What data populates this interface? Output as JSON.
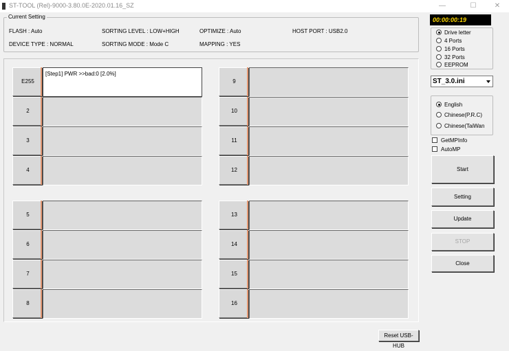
{
  "window": {
    "title": "ST-TOOL (Rel)-9000-3.80.0E-2020.01.16_SZ",
    "minimize_icon": "minimize-icon",
    "maximize_icon": "maximize-icon",
    "close_icon": "close-icon",
    "minimize_glyph": "—",
    "maximize_glyph": "☐",
    "close_glyph": "✕"
  },
  "current_setting": {
    "title": "Current Setting",
    "flash": "FLASH : Auto",
    "sorting_level": "SORTING LEVEL : LOW+HIGH",
    "optimize": "OPTIMIZE : Auto",
    "host_port": "HOST PORT : USB2.0",
    "device_type": "DEVICE TYPE : NORMAL",
    "sorting_mode": "SORTING MODE : Mode C",
    "mapping": "MAPPING : YES"
  },
  "ports": [
    {
      "label": "E255",
      "status": "[Step1] PWR  >>bad:0  [2.0%]",
      "active": true
    },
    {
      "label": "2",
      "status": ""
    },
    {
      "label": "3",
      "status": ""
    },
    {
      "label": "4",
      "status": ""
    },
    {
      "label": "5",
      "status": ""
    },
    {
      "label": "6",
      "status": ""
    },
    {
      "label": "7",
      "status": ""
    },
    {
      "label": "8",
      "status": ""
    },
    {
      "label": "9",
      "status": ""
    },
    {
      "label": "10",
      "status": ""
    },
    {
      "label": "11",
      "status": ""
    },
    {
      "label": "12",
      "status": ""
    },
    {
      "label": "13",
      "status": ""
    },
    {
      "label": "14",
      "status": ""
    },
    {
      "label": "15",
      "status": ""
    },
    {
      "label": "16",
      "status": ""
    }
  ],
  "timer": "00:00:00:19",
  "port_mode": {
    "options": [
      "Drive letter",
      "4 Ports",
      "16 Ports",
      "32 Ports",
      "EEPROM"
    ],
    "selected": "Drive letter"
  },
  "ini_file": "ST_3.0.ini",
  "language": {
    "options": [
      "English",
      "Chinese(P.R.C)",
      "Chinese(TaiWan"
    ],
    "selected": "English"
  },
  "checkboxes": {
    "get_mp_info": "GetMPInfo",
    "auto_mp": "AutoMP"
  },
  "buttons": {
    "start": "Start",
    "setting": "Setting",
    "update": "Update",
    "stop": "STOP",
    "close": "Close",
    "reset_usb_hub": "Reset USB-HUB"
  },
  "colors": {
    "timer_text": "#ffd800",
    "port_accent": "#e59a76"
  }
}
